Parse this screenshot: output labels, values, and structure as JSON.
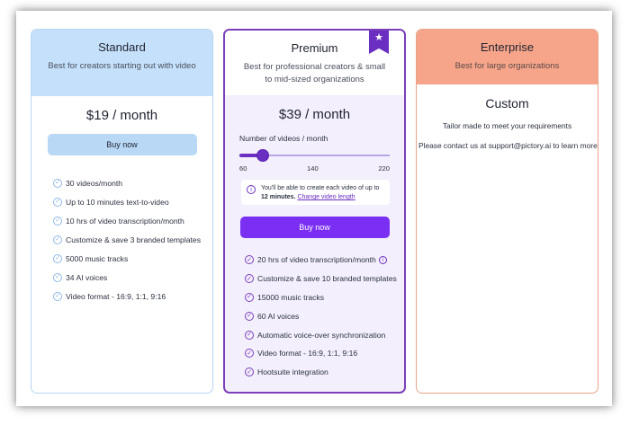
{
  "plans": {
    "standard": {
      "title": "Standard",
      "subtitle": "Best for creators starting out with video",
      "price": "$19 / month",
      "button": "Buy now",
      "features": [
        "30 videos/month",
        "Up to 10 minutes text-to-video",
        "10 hrs of video transcription/month",
        "Customize & save 3 branded templates",
        "5000 music tracks",
        "34 AI voices",
        "Video format - 16:9, 1:1, 9:16"
      ]
    },
    "premium": {
      "title": "Premium",
      "subtitle": "Best for professional creators & small to mid-sized organizations",
      "price": "$39 / month",
      "slider_label": "Number of videos / month",
      "slider": {
        "min": 60,
        "max": 220,
        "value": 85
      },
      "slider_ticks": [
        "60",
        "140",
        "220"
      ],
      "info_text_1": "You'll be able to create each video of up to ",
      "info_bold": "12 minutes.",
      "info_link": "Change video length",
      "button": "Buy now",
      "features": [
        "20 hrs of video transcription/month",
        "Customize & save 10 branded templates",
        "15000 music tracks",
        "60 AI voices",
        "Automatic voice-over synchronization",
        "Video format - 16:9, 1:1, 9:16",
        "Hootsuite integration"
      ]
    },
    "enterprise": {
      "title": "Enterprise",
      "subtitle": "Best for large organizations",
      "price": "Custom",
      "tagline": "Tailor made to meet your requirements",
      "contact": "Please contact us at support@pictory.ai to learn more"
    }
  },
  "icons": {
    "check": "check-circle-icon",
    "ribbon": "star-ribbon-icon",
    "info": "info-icon"
  },
  "colors": {
    "accent": "#7a2ff2",
    "standard_header": "#c4e0fa",
    "enterprise_header": "#f6a58a"
  }
}
